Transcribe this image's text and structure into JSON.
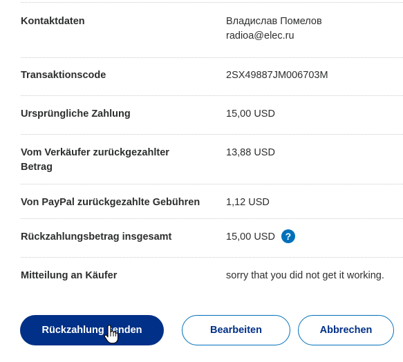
{
  "details": [
    {
      "label": "Kontaktdaten",
      "value_lines": [
        "Владислав Помелов",
        "radioa@elec.ru"
      ]
    },
    {
      "label": "Transaktionscode",
      "value": "2SX49887JM006703M"
    },
    {
      "label": "Ursprüngliche Zahlung",
      "value": "15,00 USD"
    },
    {
      "label_lines": [
        "Vom Verkäufer zurückgezahlter",
        "Betrag"
      ],
      "value": "13,88 USD"
    },
    {
      "label": "Von PayPal zurückgezahlte Gebühren",
      "value": "1,12 USD"
    },
    {
      "label": "Rückzahlungsbetrag insgesamt",
      "value": "15,00 USD",
      "help_icon": "?"
    },
    {
      "label": "Mitteilung an Käufer",
      "value": "sorry that you did not get it working."
    }
  ],
  "actions": {
    "send_refund": "Rückzahlung senden",
    "edit": "Bearbeiten",
    "cancel": "Abbrechen"
  },
  "colors": {
    "primary": "#003087",
    "accent": "#0070ba",
    "text": "#2c2e2f"
  },
  "icons": {
    "help": "question-circle-icon",
    "cursor": "hand-pointer-cursor-icon"
  }
}
